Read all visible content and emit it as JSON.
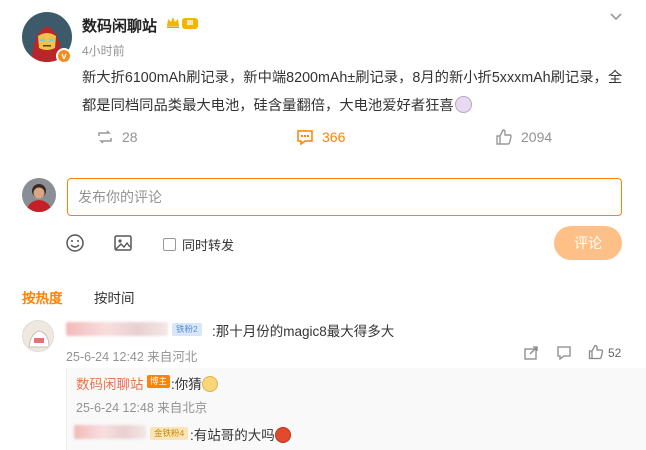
{
  "post": {
    "author": "数码闲聊站",
    "level_badge": "Ⅲ",
    "time": "4小时前",
    "text": "新大折6100mAh刷记录，新中端8200mAh±刷记录，8月的新小折5xxxmAh刷记录，全都是同档同品类最大电池，硅含量翻倍，大电池爱好者狂喜",
    "actions": {
      "reposts": "28",
      "comments": "366",
      "likes": "2094"
    }
  },
  "composer": {
    "placeholder": "发布你的评论",
    "repost_label": "同时转发",
    "submit_label": "评论"
  },
  "sort_tabs": {
    "hot": "按热度",
    "time": "按时间"
  },
  "comments": [
    {
      "fan_badge": "铁粉2",
      "text": ":那十月份的magic8最大得多大",
      "meta": "25-6-24 12:42 来自河北",
      "likes": "52"
    }
  ],
  "replies": [
    {
      "nick": "数码闲聊站",
      "badge": "博主",
      "text": ":你猜",
      "meta": "25-6-24 12:48 来自北京"
    },
    {
      "fan_badge": "金铁粉4",
      "text": ":有站哥的大吗"
    }
  ],
  "colors": {
    "accent": "#ff8200",
    "nick": "#eb7350",
    "muted": "#939393"
  }
}
